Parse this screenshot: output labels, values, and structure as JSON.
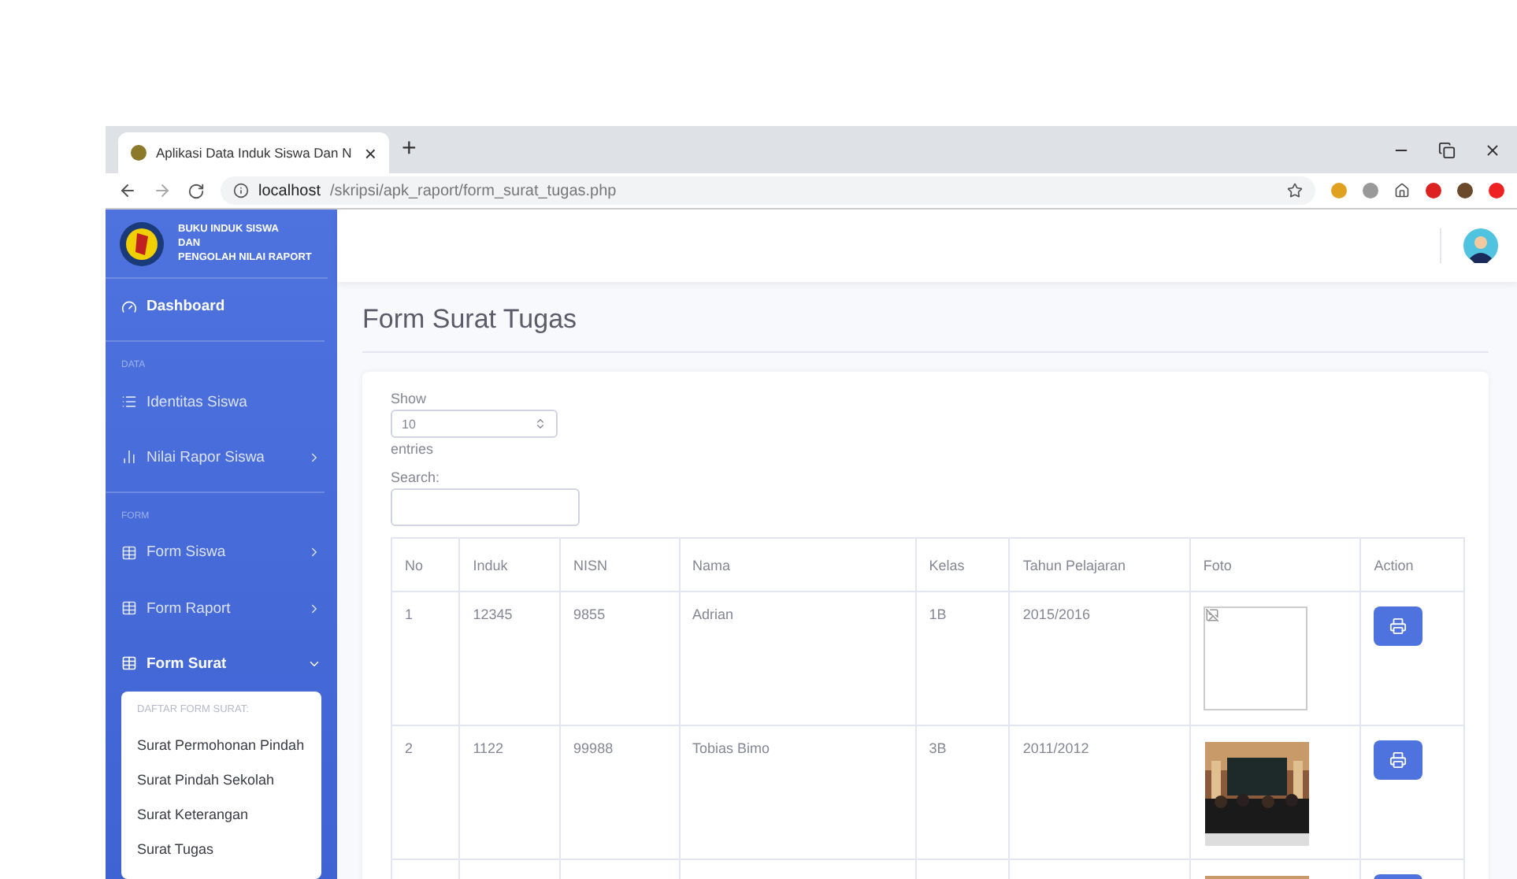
{
  "browser": {
    "tab_title": "Aplikasi Data Induk Siswa Dan N",
    "tab_close": "×",
    "new_tab": "+",
    "url_host": "localhost",
    "url_path": "/skripsi/apk_raport/form_surat_tugas.php"
  },
  "sidebar": {
    "brand": [
      "BUKU INDUK SISWA",
      "DAN",
      "PENGOLAH NILAI RAPORT"
    ],
    "nav": [
      {
        "kind": "link",
        "label": "Dashboard",
        "selected": true
      },
      {
        "kind": "heading",
        "label": "DATA"
      },
      {
        "kind": "link",
        "label": "Identitas Siswa",
        "selected": false
      },
      {
        "kind": "group",
        "label": "Nilai Rapor Siswa",
        "selected": false,
        "expanded": false
      },
      {
        "kind": "heading",
        "label": "FORM"
      },
      {
        "kind": "group",
        "label": "Form Siswa",
        "selected": false,
        "expanded": false
      },
      {
        "kind": "group",
        "label": "Form Raport",
        "selected": false,
        "expanded": false
      },
      {
        "kind": "group",
        "label": "Form Surat",
        "selected": true,
        "expanded": true
      }
    ],
    "submenu": {
      "heading": "DAFTAR FORM SURAT:",
      "items": [
        "Surat Permohonan Pindah",
        "Surat Pindah Sekolah",
        "Surat Keterangan",
        "Surat Tugas"
      ]
    }
  },
  "page": {
    "title": "Form Surat Tugas",
    "show_label": "Show",
    "page_size": "10",
    "entries_label": "entries",
    "search_label": "Search:"
  },
  "table": {
    "columns": [
      "No",
      "Induk",
      "NISN",
      "Nama",
      "Kelas",
      "Tahun Pelajaran",
      "Foto",
      "Action"
    ],
    "rows": [
      {
        "no": "1",
        "induk": "12345",
        "nisn": "9855",
        "nama": "Adrian",
        "kelas": "1B",
        "tahun": "2015/2016",
        "foto": {
          "kind": "broken"
        }
      },
      {
        "no": "2",
        "induk": "1122",
        "nisn": "99988",
        "nama": "Tobias Bimo",
        "kelas": "3B",
        "tahun": "2011/2012",
        "foto": {
          "kind": "picture"
        }
      },
      {
        "foto": {
          "kind": "picture"
        }
      }
    ]
  }
}
